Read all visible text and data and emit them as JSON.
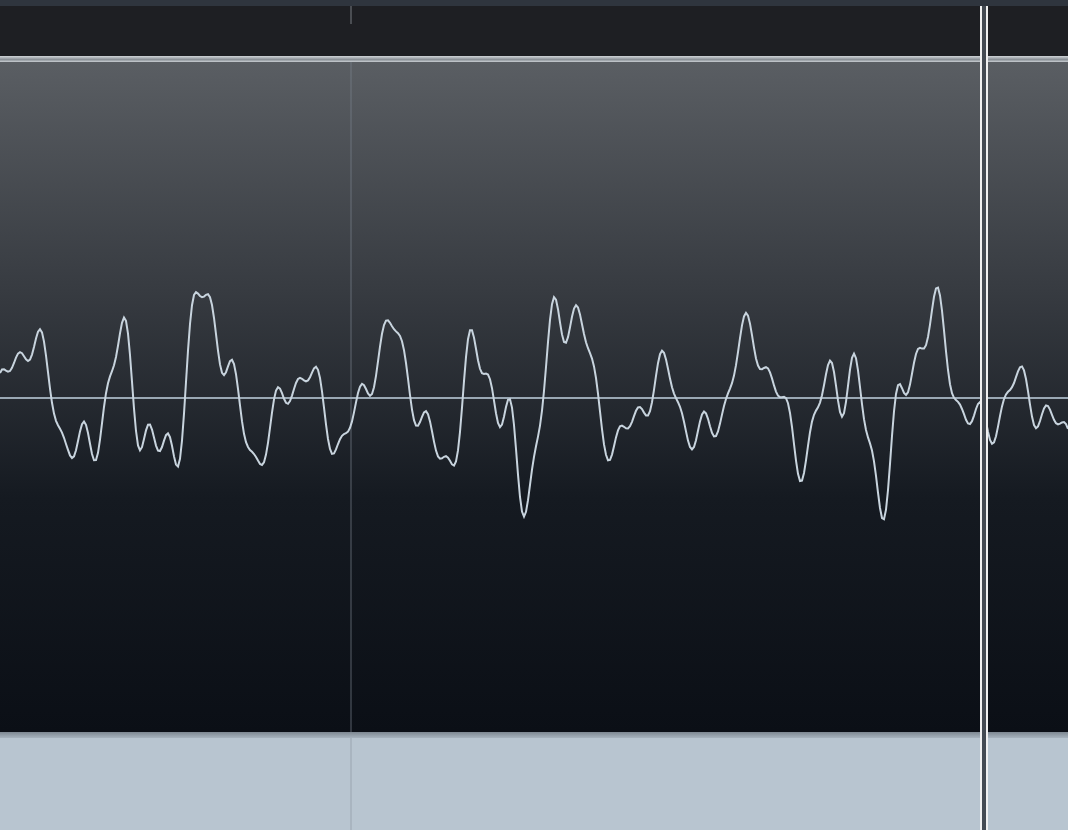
{
  "editor": {
    "kind": "waveform"
  }
}
